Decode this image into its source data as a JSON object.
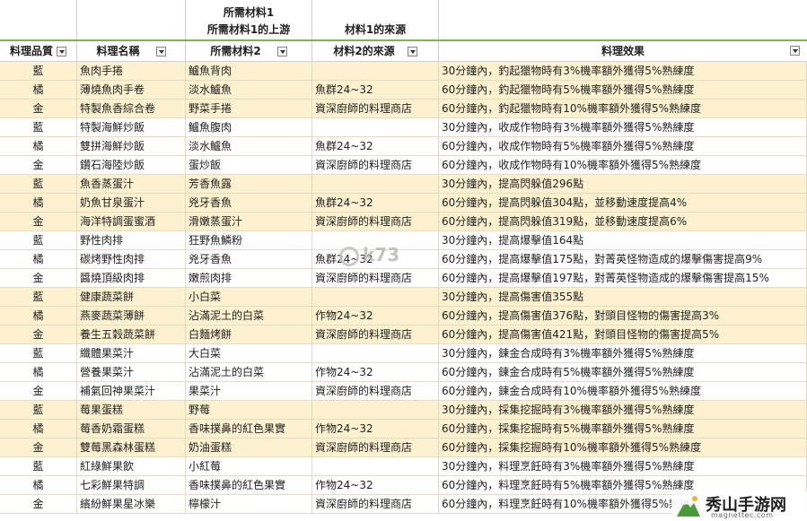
{
  "header": {
    "top_row": {
      "col3": "所需材料1"
    },
    "mid_row": {
      "col3": "所需材料1的上游",
      "col4": "材料1的來源"
    },
    "columns": [
      "料理品質",
      "料理名稱",
      "所需材料2",
      "材料2的來源",
      "料理效果"
    ]
  },
  "rows": [
    {
      "quality": "藍",
      "name": "魚肉手捲",
      "mat": "鱸魚背肉",
      "source": "",
      "effect": "30分鐘內，釣起獵物時有3%機率額外獲得5%熟練度",
      "bg": "y"
    },
    {
      "quality": "橘",
      "name": "薄燒魚肉手卷",
      "mat": "淡水鱸魚",
      "source": "魚群24~32",
      "effect": "60分鐘內，釣起獵物時有5%機率額外獲得5%熟練度",
      "bg": "y"
    },
    {
      "quality": "金",
      "name": "特製魚香綜合卷",
      "mat": "野菜手捲",
      "source": "資深廚師的料理商店",
      "effect": "60分鐘內，釣起獵物時有10%機率額外獲得5%熟練度",
      "bg": "y"
    },
    {
      "quality": "藍",
      "name": "特製海鮮炒飯",
      "mat": "鱸魚腹肉",
      "source": "",
      "effect": "30分鐘內，收成作物時有3%機率額外獲得5%熟練度",
      "bg": "w"
    },
    {
      "quality": "橘",
      "name": "雙拼海鮮炒飯",
      "mat": "淡水鱸魚",
      "source": "魚群24~32",
      "effect": "60分鐘內，收成作物時有5%機率額外獲得5%熟練度",
      "bg": "w"
    },
    {
      "quality": "金",
      "name": "鑽石海陸炒飯",
      "mat": "蛋炒飯",
      "source": "資深廚師的料理商店",
      "effect": "60分鐘內，收成作物時有10%機率額外獲得5%熟練度",
      "bg": "w"
    },
    {
      "quality": "藍",
      "name": "魚香蒸蛋汁",
      "mat": "芳香魚露",
      "source": "",
      "effect": "30分鐘內，提高閃躲值296點",
      "bg": "y"
    },
    {
      "quality": "橘",
      "name": "奶魚甘泉蛋汁",
      "mat": "兇牙香魚",
      "source": "魚群24~32",
      "effect": "60分鐘內，提高閃躲值304點，並移動速度提高4%",
      "bg": "y"
    },
    {
      "quality": "金",
      "name": "海洋特調蛋蜜酒",
      "mat": "滑嫩蒸蛋汁",
      "source": "資深廚師的料理商店",
      "effect": "60分鐘內，提高閃躲值319點，並移動速度提高6%",
      "bg": "y"
    },
    {
      "quality": "藍",
      "name": "野性肉排",
      "mat": "狂野魚鱗粉",
      "source": "",
      "effect": "30分鐘內，提高爆擊值164點",
      "bg": "w"
    },
    {
      "quality": "橘",
      "name": "碳烤野性肉排",
      "mat": "兇牙香魚",
      "source": "魚群24~32",
      "effect": "60分鐘內，提高爆擊值175點，對菁英怪物造成的爆擊傷害提高9%",
      "bg": "w"
    },
    {
      "quality": "金",
      "name": "醬燒頂級肉排",
      "mat": "嫩煎肉排",
      "source": "資深廚師的料理商店",
      "effect": "60分鐘內，提高爆擊值197點，對菁英怪物造成的爆擊傷害提高15%",
      "bg": "w"
    },
    {
      "quality": "藍",
      "name": "健康蔬菜餅",
      "mat": "小白菜",
      "source": "",
      "effect": "30分鐘內，提高傷害值355點",
      "bg": "y"
    },
    {
      "quality": "橘",
      "name": "燕麥蔬菜薄餅",
      "mat": "沾滿泥土的白菜",
      "source": "作物24~32",
      "effect": "60分鐘內，提高傷害值376點，對頭目怪物的傷害提高3%",
      "bg": "y"
    },
    {
      "quality": "金",
      "name": "養生五穀蔬菜餅",
      "mat": "白麵烤餅",
      "source": "資深廚師的料理商店",
      "effect": "60分鐘內，提高傷害值421點，對頭目怪物的傷害提高5%",
      "bg": "y"
    },
    {
      "quality": "藍",
      "name": "纖體果菜汁",
      "mat": "大白菜",
      "source": "",
      "effect": "30分鐘內，鍊金合成時有3%機率額外獲得5%熟練度",
      "bg": "w"
    },
    {
      "quality": "橘",
      "name": "營養果菜汁",
      "mat": "沾滿泥土的白菜",
      "source": "作物24~32",
      "effect": "60分鐘內，鍊金合成時有5%機率額外獲得5%熟練度",
      "bg": "w"
    },
    {
      "quality": "金",
      "name": "補氣回神果菜汁",
      "mat": "果菜汁",
      "source": "資深廚師的料理商店",
      "effect": "60分鐘內，鍊金合成時有10%機率額外獲得5%熟練度",
      "bg": "w"
    },
    {
      "quality": "藍",
      "name": "莓果蛋糕",
      "mat": "野莓",
      "source": "",
      "effect": "30分鐘內，採集挖掘時有3%機率額外獲得5%熟練度",
      "bg": "y"
    },
    {
      "quality": "橘",
      "name": "莓香奶霜蛋糕",
      "mat": "香味撲鼻的紅色果實",
      "source": "作物24~32",
      "effect": "60分鐘內，採集挖掘時有5%機率額外獲得5%熟練度",
      "bg": "y"
    },
    {
      "quality": "金",
      "name": "雙莓黑森林蛋糕",
      "mat": "奶油蛋糕",
      "source": "資深廚師的料理商店",
      "effect": "60分鐘內，採集挖掘時有10%機率額外獲得5%熟練度",
      "bg": "y"
    },
    {
      "quality": "藍",
      "name": "紅綠鮮果飲",
      "mat": "小紅莓",
      "source": "",
      "effect": "30分鐘內，料理烹飪時有3%機率額外獲得5%熟練度",
      "bg": "w"
    },
    {
      "quality": "橘",
      "name": "七彩鮮果特調",
      "mat": "香味撲鼻的紅色果實",
      "source": "作物24~32",
      "effect": "60分鐘內，料理烹飪時有5%機率額外獲得5%熟練度",
      "bg": "w"
    },
    {
      "quality": "金",
      "name": "繽紛鮮果星冰樂",
      "mat": "檸檬汁",
      "source": "資深廚師的料理商店",
      "effect": "60分鐘內，料理烹飪時有10%機率額外獲得5%熟練度",
      "bg": "w"
    }
  ],
  "watermark": "k73",
  "logo": {
    "text": "秀山手游网",
    "sub": "magnettec.com"
  },
  "colors": {
    "row_highlight": "#fdf1d0",
    "header_line": "#7ab648"
  }
}
